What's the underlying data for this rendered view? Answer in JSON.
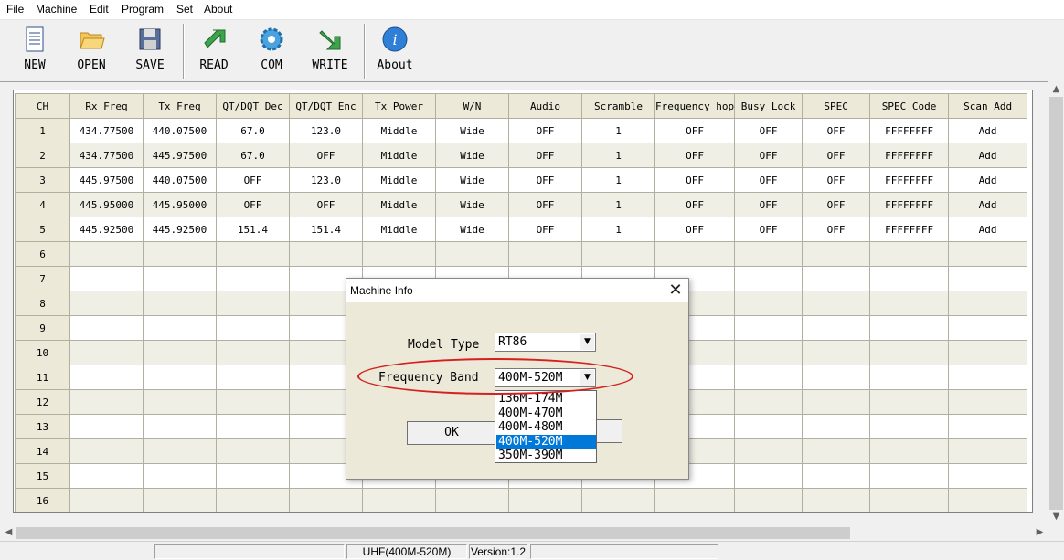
{
  "menu": [
    "File",
    "Machine",
    "Edit",
    "Program",
    "Set",
    "About"
  ],
  "toolbar": {
    "new": "NEW",
    "open": "OPEN",
    "save": "SAVE",
    "read": "READ",
    "com": "COM",
    "write": "WRITE",
    "about": "About"
  },
  "grid": {
    "headers": [
      "CH",
      "Rx Freq",
      "Tx Freq",
      "QT/DQT Dec",
      "QT/DQT Enc",
      "Tx Power",
      "W/N",
      "Audio",
      "Scramble",
      "Frequency hop",
      "Busy Lock",
      "SPEC",
      "SPEC Code",
      "Scan Add"
    ],
    "rows": [
      [
        "1",
        "434.77500",
        "440.07500",
        "67.0",
        "123.0",
        "Middle",
        "Wide",
        "OFF",
        "1",
        "OFF",
        "OFF",
        "OFF",
        "FFFFFFFF",
        "Add"
      ],
      [
        "2",
        "434.77500",
        "445.97500",
        "67.0",
        "OFF",
        "Middle",
        "Wide",
        "OFF",
        "1",
        "OFF",
        "OFF",
        "OFF",
        "FFFFFFFF",
        "Add"
      ],
      [
        "3",
        "445.97500",
        "440.07500",
        "OFF",
        "123.0",
        "Middle",
        "Wide",
        "OFF",
        "1",
        "OFF",
        "OFF",
        "OFF",
        "FFFFFFFF",
        "Add"
      ],
      [
        "4",
        "445.95000",
        "445.95000",
        "OFF",
        "OFF",
        "Middle",
        "Wide",
        "OFF",
        "1",
        "OFF",
        "OFF",
        "OFF",
        "FFFFFFFF",
        "Add"
      ],
      [
        "5",
        "445.92500",
        "445.92500",
        "151.4",
        "151.4",
        "Middle",
        "Wide",
        "OFF",
        "1",
        "OFF",
        "OFF",
        "OFF",
        "FFFFFFFF",
        "Add"
      ],
      [
        "6",
        "",
        "",
        "",
        "",
        "",
        "",
        "",
        "",
        "",
        "",
        "",
        "",
        ""
      ],
      [
        "7",
        "",
        "",
        "",
        "",
        "",
        "",
        "",
        "",
        "",
        "",
        "",
        "",
        ""
      ],
      [
        "8",
        "",
        "",
        "",
        "",
        "",
        "",
        "",
        "",
        "",
        "",
        "",
        "",
        ""
      ],
      [
        "9",
        "",
        "",
        "",
        "",
        "",
        "",
        "",
        "",
        "",
        "",
        "",
        "",
        ""
      ],
      [
        "10",
        "",
        "",
        "",
        "",
        "",
        "",
        "",
        "",
        "",
        "",
        "",
        "",
        ""
      ],
      [
        "11",
        "",
        "",
        "",
        "",
        "",
        "",
        "",
        "",
        "",
        "",
        "",
        "",
        ""
      ],
      [
        "12",
        "",
        "",
        "",
        "",
        "",
        "",
        "",
        "",
        "",
        "",
        "",
        "",
        ""
      ],
      [
        "13",
        "",
        "",
        "",
        "",
        "",
        "",
        "",
        "",
        "",
        "",
        "",
        "",
        ""
      ],
      [
        "14",
        "",
        "",
        "",
        "",
        "",
        "",
        "",
        "",
        "",
        "",
        "",
        "",
        ""
      ],
      [
        "15",
        "",
        "",
        "",
        "",
        "",
        "",
        "",
        "",
        "",
        "",
        "",
        "",
        ""
      ],
      [
        "16",
        "",
        "",
        "",
        "",
        "",
        "",
        "",
        "",
        "",
        "",
        "",
        "",
        ""
      ]
    ]
  },
  "dialog": {
    "title": "Machine Info",
    "model_label": "Model Type",
    "model_value": "RT86",
    "band_label": "Frequency Band",
    "band_value": "400M-520M",
    "band_options": [
      "136M-174M",
      "400M-470M",
      "400M-480M",
      "400M-520M",
      "350M-390M"
    ],
    "band_selected_index": 3,
    "ok_label": "OK"
  },
  "status": {
    "band": "UHF(400M-520M)",
    "version": "Version:1.2"
  },
  "colors": {
    "highlight_ellipse": "#d42020",
    "selection": "#0078d7"
  }
}
